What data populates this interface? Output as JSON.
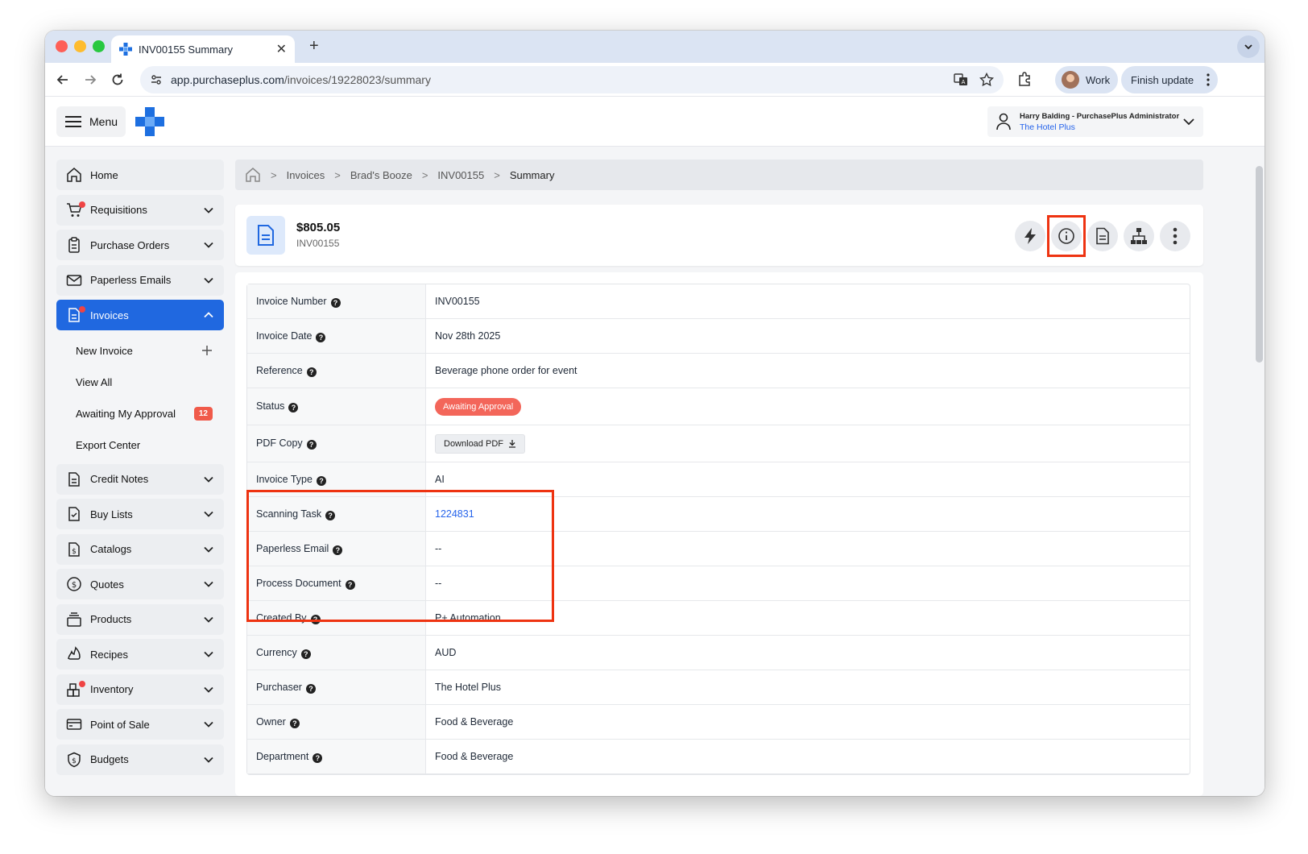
{
  "browser": {
    "tab_title": "INV00155 Summary",
    "url_host": "app.purchaseplus.com",
    "url_path": "/invoices/19228023/summary",
    "profile_label": "Work",
    "finish_update_label": "Finish update"
  },
  "header": {
    "menu_label": "Menu",
    "user_name": "Harry Balding - PurchasePlus Administrator",
    "user_org": "The Hotel Plus"
  },
  "sidebar": {
    "items": [
      {
        "label": "Home",
        "icon": "home-icon"
      },
      {
        "label": "Requisitions",
        "icon": "cart-icon"
      },
      {
        "label": "Purchase Orders",
        "icon": "clipboard-icon"
      },
      {
        "label": "Paperless Emails",
        "icon": "mail-icon"
      },
      {
        "label": "Invoices",
        "icon": "document-icon"
      },
      {
        "label": "Credit Notes",
        "icon": "document-icon"
      },
      {
        "label": "Buy Lists",
        "icon": "checklist-icon"
      },
      {
        "label": "Catalogs",
        "icon": "dollar-document-icon"
      },
      {
        "label": "Quotes",
        "icon": "dollar-circle-icon"
      },
      {
        "label": "Products",
        "icon": "stack-icon"
      },
      {
        "label": "Recipes",
        "icon": "flame-icon"
      },
      {
        "label": "Inventory",
        "icon": "boxes-icon"
      },
      {
        "label": "Point of Sale",
        "icon": "card-icon"
      },
      {
        "label": "Budgets",
        "icon": "shield-dollar-icon"
      }
    ],
    "invoice_sub": [
      {
        "label": "New Invoice"
      },
      {
        "label": "View All"
      },
      {
        "label": "Awaiting My Approval",
        "badge": "12"
      },
      {
        "label": "Export Center"
      }
    ]
  },
  "breadcrumb": [
    "Invoices",
    "Brad's Booze",
    "INV00155",
    "Summary"
  ],
  "summary": {
    "amount": "$805.05",
    "invoice_number": "INV00155"
  },
  "details": [
    {
      "label": "Invoice Number",
      "value": "INV00155"
    },
    {
      "label": "Invoice Date",
      "value": "Nov 28th 2025"
    },
    {
      "label": "Reference",
      "value": "Beverage phone order for event"
    },
    {
      "label": "Status",
      "value": "Awaiting Approval"
    },
    {
      "label": "PDF Copy",
      "value": "Download PDF"
    },
    {
      "label": "Invoice Type",
      "value": "AI"
    },
    {
      "label": "Scanning Task",
      "value": "1224831"
    },
    {
      "label": "Paperless Email",
      "value": "--"
    },
    {
      "label": "Process Document",
      "value": "--"
    },
    {
      "label": "Created By",
      "value": "P+ Automation"
    },
    {
      "label": "Currency",
      "value": "AUD"
    },
    {
      "label": "Purchaser",
      "value": "The Hotel Plus"
    },
    {
      "label": "Owner",
      "value": "Food & Beverage"
    },
    {
      "label": "Department",
      "value": "Food & Beverage"
    }
  ],
  "colors": {
    "primary": "#2068e0",
    "status_pill": "#f3665a",
    "highlight_box": "#ee3311",
    "link": "#2563eb"
  }
}
